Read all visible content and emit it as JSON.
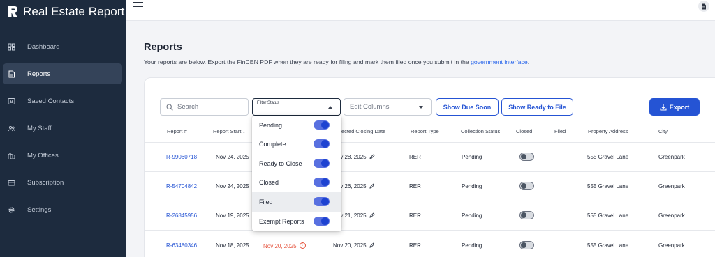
{
  "app": {
    "name": "Real Estate Report"
  },
  "sidebar": {
    "items": [
      {
        "label": "Dashboard",
        "icon": "dashboard-icon",
        "active": false
      },
      {
        "label": "Reports",
        "icon": "document-icon",
        "active": true
      },
      {
        "label": "Saved Contacts",
        "icon": "contacts-icon",
        "active": false
      },
      {
        "label": "My Staff",
        "icon": "staff-icon",
        "active": false
      },
      {
        "label": "My Offices",
        "icon": "offices-icon",
        "active": false
      },
      {
        "label": "Subscription",
        "icon": "card-icon",
        "active": false
      },
      {
        "label": "Settings",
        "icon": "gear-icon",
        "active": false
      }
    ]
  },
  "page": {
    "title": "Reports",
    "subtitle": "Your reports are below. Export the FinCEN PDF when they are ready for filing and mark them filed once you submit in the",
    "subtitle_link": "government interface",
    "subtitle_end": "."
  },
  "toolbar": {
    "search_placeholder": "Search",
    "filter_legend": "Filter Status",
    "edit_columns_label": "Edit Columns",
    "show_due_soon": "Show Due Soon",
    "show_ready": "Show Ready to File",
    "export": "Export"
  },
  "filter_menu": {
    "options": [
      {
        "label": "Pending",
        "on": true
      },
      {
        "label": "Complete",
        "on": true
      },
      {
        "label": "Ready to Close",
        "on": true
      },
      {
        "label": "Closed",
        "on": true
      },
      {
        "label": "Filed",
        "on": true
      },
      {
        "label": "Exempt Reports",
        "on": true
      }
    ]
  },
  "table": {
    "headers": [
      "Report #",
      "Report Start",
      "Expected Closing Date",
      "Report Type",
      "Collection Status",
      "Closed",
      "Filed",
      "Property Address",
      "City"
    ],
    "rows": [
      {
        "id": "R-99060718",
        "start": "Nov 24, 2025",
        "due": "",
        "closing": "Nov 28, 2025",
        "type": "RER",
        "status": "Pending",
        "address": "555 Gravel Lane",
        "city": "Greenpark"
      },
      {
        "id": "R-54704842",
        "start": "Nov 24, 2025",
        "due": "",
        "closing": "Nov 26, 2025",
        "type": "RER",
        "status": "Pending",
        "address": "555 Gravel Lane",
        "city": "Greenpark"
      },
      {
        "id": "R-26845956",
        "start": "Nov 19, 2025",
        "due": "",
        "closing": "Nov 21, 2025",
        "type": "RER",
        "status": "Pending",
        "address": "555 Gravel Lane",
        "city": "Greenpark"
      },
      {
        "id": "R-63480346",
        "start": "Nov 18, 2025",
        "due": "Nov 20, 2025",
        "closing": "Nov 20, 2025",
        "type": "RER",
        "status": "Pending",
        "address": "555 Gravel Lane",
        "city": "Greenpark"
      }
    ]
  }
}
